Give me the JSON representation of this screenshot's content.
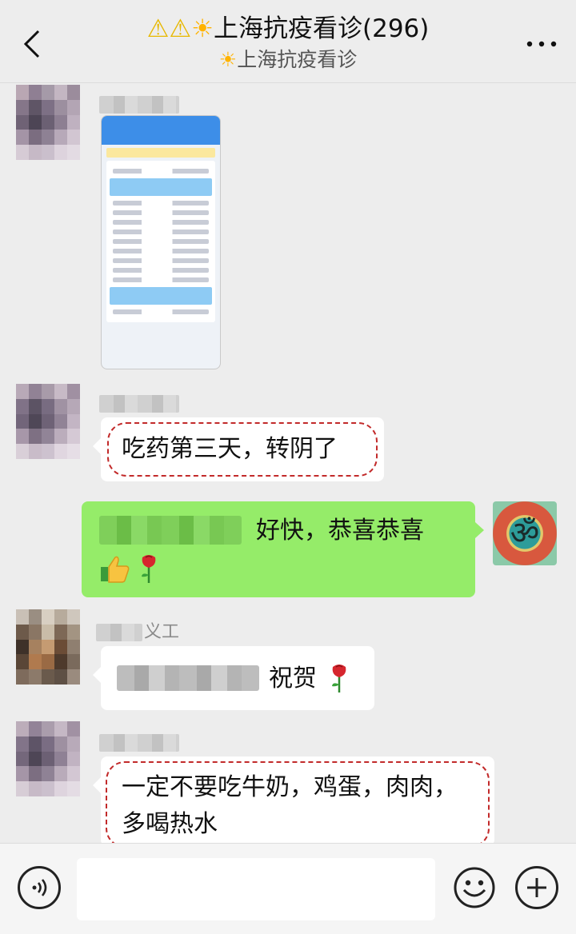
{
  "header": {
    "title_prefix": "⚠⚠",
    "title_sun": "☀",
    "title": "上海抗疫看诊(296)",
    "subtitle_sun": "☀",
    "subtitle": "上海抗疫看诊",
    "back_icon": "chevron-left-icon",
    "more_icon": "more-horizontal-icon"
  },
  "messages": [
    {
      "type": "image",
      "sender": "",
      "description_icon": "phone-screenshot"
    },
    {
      "type": "text",
      "sender": "",
      "text": "吃药第三天，转阴了",
      "highlighted": true
    },
    {
      "type": "text",
      "mine": true,
      "text": "好快，恭喜恭喜",
      "emojis": [
        "thumbs-up-icon",
        "rose-icon"
      ]
    },
    {
      "type": "text",
      "sender": "义工",
      "text": "祝贺",
      "emojis": [
        "rose-icon"
      ]
    },
    {
      "type": "text",
      "sender": "",
      "text_line1": "一定不要吃牛奶，鸡蛋，肉肉，",
      "text_line2": "多喝热水",
      "highlighted": true
    }
  ],
  "self_avatar_symbol": "ॐ",
  "input": {
    "value": "",
    "placeholder": ""
  },
  "colors": {
    "background": "#ededed",
    "bubble_mine": "#95ec69",
    "highlight_dash": "#c22a2a"
  }
}
